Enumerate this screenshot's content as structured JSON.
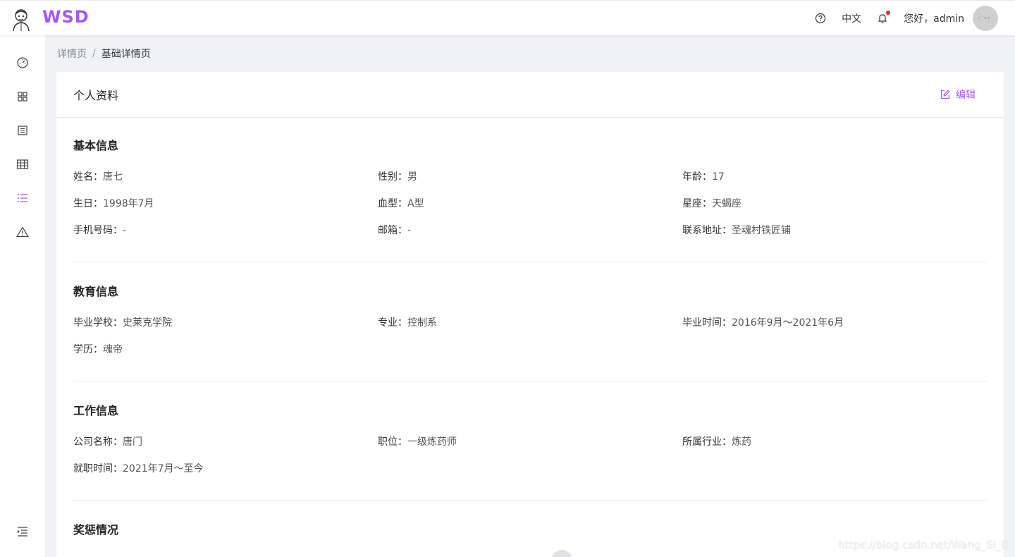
{
  "header": {
    "logo_text": "WSD",
    "language": "中文",
    "greeting": "您好，admin",
    "avatar_text": "ㄏ ˇ ㄨ ㄛ ˋ"
  },
  "sidebar": {
    "items": [
      {
        "icon": "dashboard-icon"
      },
      {
        "icon": "grid-icon"
      },
      {
        "icon": "form-icon"
      },
      {
        "icon": "table-icon"
      },
      {
        "icon": "list-icon",
        "active": true
      },
      {
        "icon": "warning-icon"
      }
    ],
    "collapse_icon": "menu-fold-icon"
  },
  "breadcrumb": {
    "parent": "详情页",
    "separator": "/",
    "current": "基础详情页"
  },
  "card": {
    "title": "个人资料",
    "edit_label": "编辑"
  },
  "sections": {
    "basic": {
      "title": "基本信息",
      "fields": [
        {
          "label": "姓名：",
          "value": "唐七"
        },
        {
          "label": "性别：",
          "value": "男"
        },
        {
          "label": "年龄：",
          "value": "17"
        },
        {
          "label": "生日：",
          "value": "1998年7月"
        },
        {
          "label": "血型：",
          "value": "A型"
        },
        {
          "label": "星座：",
          "value": "天蝎座"
        },
        {
          "label": "手机号码：",
          "value": "-"
        },
        {
          "label": "邮箱：",
          "value": "-"
        },
        {
          "label": "联系地址：",
          "value": "圣魂村铁匠铺"
        }
      ]
    },
    "education": {
      "title": "教育信息",
      "fields": [
        {
          "label": "毕业学校：",
          "value": "史莱克学院"
        },
        {
          "label": "专业：",
          "value": "控制系"
        },
        {
          "label": "毕业时间：",
          "value": "2016年9月～2021年6月"
        },
        {
          "label": "学历：",
          "value": "魂帝"
        }
      ]
    },
    "work": {
      "title": "工作信息",
      "fields": [
        {
          "label": "公司名称：",
          "value": "唐门"
        },
        {
          "label": "职位：",
          "value": "一级炼药师"
        },
        {
          "label": "所属行业：",
          "value": "炼药"
        },
        {
          "label": "就职时间：",
          "value": "2021年7月～至今"
        }
      ]
    },
    "awards": {
      "title": "奖惩情况"
    }
  },
  "watermark": "https://blog.csdn.net/Wang_Si_D",
  "colors": {
    "accent": "#a855f7",
    "notify": "#f5222d"
  }
}
